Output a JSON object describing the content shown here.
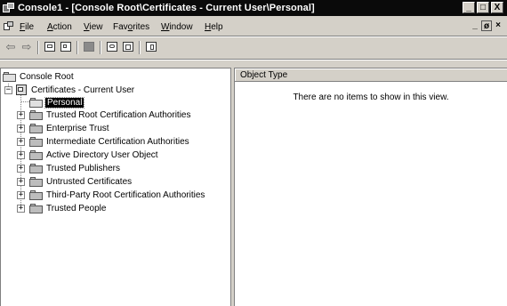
{
  "window": {
    "title": "Console1 - [Console Root\\Certificates - Current User\\Personal]",
    "controls": {
      "minimize": "_",
      "restore": "□",
      "close": "X"
    }
  },
  "menubar": {
    "items": [
      {
        "label": "File",
        "accel": "F",
        "rest": "ile"
      },
      {
        "label": "Action",
        "accel": "A",
        "rest": "ction"
      },
      {
        "label": "View",
        "accel": "V",
        "rest": "iew"
      },
      {
        "label": "Favorites",
        "pre": "Fav",
        "accel": "o",
        "rest": "rites"
      },
      {
        "label": "Window",
        "accel": "W",
        "rest": "indow"
      },
      {
        "label": "Help",
        "accel": "H",
        "rest": "elp"
      }
    ],
    "mdi_controls": {
      "minimize": "_",
      "restore": "ø",
      "close": "×"
    }
  },
  "toolbar": {
    "icons": [
      "back-arrow-icon",
      "forward-arrow-icon",
      "up-folder-icon",
      "show-hide-tree-icon",
      "delete-icon",
      "refresh-icon",
      "export-list-icon",
      "help-icon"
    ]
  },
  "tree": {
    "root": "Console Root",
    "snapin": "Certificates - Current User",
    "selected": "Personal",
    "stores": [
      "Trusted Root Certification Authorities",
      "Enterprise Trust",
      "Intermediate Certification Authorities",
      "Active Directory User Object",
      "Trusted Publishers",
      "Untrusted Certificates",
      "Third-Party Root Certification Authorities",
      "Trusted People"
    ]
  },
  "detail": {
    "column_header": "Object Type",
    "empty_message": "There are no items to show in this view."
  }
}
